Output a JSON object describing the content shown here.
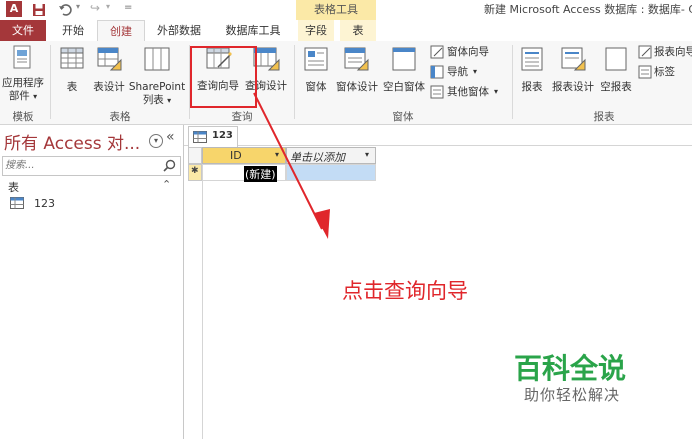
{
  "window": {
    "title": "新建 Microsoft Access 数据库 : 数据库- C",
    "context_group": "表格工具",
    "qat": {
      "redo_glyph": "↪",
      "customize_glyph": "="
    }
  },
  "tabs": [
    {
      "label": "文件"
    },
    {
      "label": "开始"
    },
    {
      "label": "创建"
    },
    {
      "label": "外部数据"
    },
    {
      "label": "数据库工具"
    },
    {
      "label": "字段"
    },
    {
      "label": "表"
    }
  ],
  "ribbon": {
    "groups": {
      "templates": "模板",
      "tables": "表格",
      "queries": "查询",
      "forms": "窗体",
      "reports": "报表"
    },
    "buttons": {
      "app_parts_line1": "应用程序",
      "app_parts_line2": "部件",
      "table": "表",
      "table_design": "表设计",
      "sharepoint_line1": "SharePoint",
      "sharepoint_line2": "列表",
      "query_wizard": "查询向导",
      "query_design": "查询设计",
      "form": "窗体",
      "form_design": "窗体设计",
      "blank_form": "空白窗体",
      "form_wizard": "窗体向导",
      "navigation": "导航",
      "more_forms": "其他窗体",
      "report": "报表",
      "report_design": "报表设计",
      "blank_report": "空报表",
      "report_wizard": "报表向导",
      "labels": "标签"
    }
  },
  "nav": {
    "title": "所有 Access 对...",
    "search_placeholder": "搜索...",
    "section": "表",
    "items": [
      {
        "label": "123"
      }
    ]
  },
  "document": {
    "tab_label": "123",
    "columns": [
      {
        "label": "ID"
      },
      {
        "label": "单击以添加"
      }
    ],
    "new_row_marker": "✱",
    "new_row_value": "(新建)"
  },
  "annotation": {
    "text": "点击查询向导"
  },
  "watermark": {
    "brand": "百科全说",
    "tagline": "助你轻松解决"
  },
  "colors": {
    "access_accent": "#a4373a",
    "context_tab": "#fbe9a7",
    "highlight_box": "#e0262b",
    "annotation_red": "#e0262b",
    "header_gold": "#f7d56b",
    "new_row_blue": "#c3dcf5",
    "watermark_green": "#2aa44a"
  }
}
